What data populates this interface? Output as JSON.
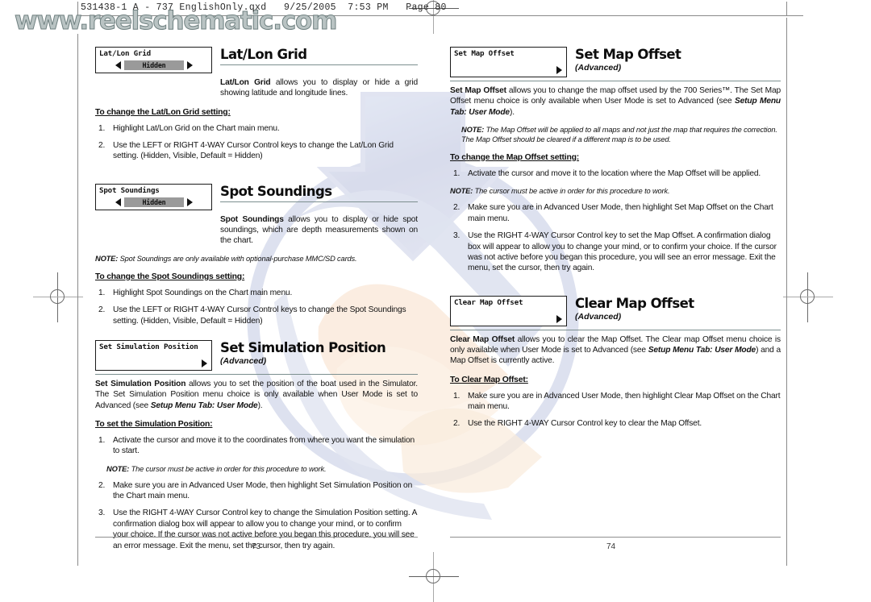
{
  "file_header": "531438-1 A - 737 EnglishOnly.qxd   9/25/2005  7:53 PM   Page 80",
  "site_watermark": "www.reelschematic.com",
  "pages": {
    "left_number": "73",
    "right_number": "74"
  },
  "left_column": {
    "sections": [
      {
        "menu": {
          "label": "Lat/Lon Grid",
          "value": "Hidden",
          "type": "option"
        },
        "title": "Lat/Lon Grid",
        "subtitle": "",
        "intro_lead": "Lat/Lon Grid",
        "intro_rest": " allows you to display or hide a grid showing latitude and longitude lines.",
        "procedure_heading": "To change the Lat/Lon Grid setting:",
        "steps": [
          {
            "num": "1.",
            "text": "Highlight Lat/Lon Grid on the Chart main menu."
          },
          {
            "num": "2.",
            "text": "Use the LEFT or RIGHT 4-WAY Cursor Control keys to change the Lat/Lon Grid setting. (Hidden, Visible, Default = Hidden)"
          }
        ]
      },
      {
        "menu": {
          "label": "Spot Soundings",
          "value": "Hidden",
          "type": "option"
        },
        "title": "Spot Soundings",
        "subtitle": "",
        "intro_lead": "Spot Soundings",
        "intro_rest": " allows you to display or hide spot soundings, which are depth measurements shown on the chart.",
        "note": {
          "label": "NOTE:",
          "text": " Spot Soundings are only available with optional-purchase MMC/SD cards."
        },
        "procedure_heading": "To change the Spot Soundings setting:",
        "steps": [
          {
            "num": "1.",
            "text": "Highlight Spot Soundings on the Chart main menu."
          },
          {
            "num": "2.",
            "text": "Use the LEFT or RIGHT 4-WAY Cursor Control keys to change the Spot Soundings setting. (Hidden, Visible, Default = Hidden)"
          }
        ]
      },
      {
        "menu": {
          "label": "Set Simulation Position",
          "value": "",
          "type": "submenu"
        },
        "title": "Set Simulation Position",
        "subtitle": "(Advanced)",
        "intro_lead": "Set Simulation Position",
        "intro_rest": " allows you to set the position of the boat used in the Simulator. The Set Simulation Position menu choice is only available when User Mode is set to Advanced (see ",
        "intro_ref": "Setup Menu Tab: User Mode",
        "intro_tail": ").",
        "procedure_heading": "To set the Simulation Position:",
        "steps": [
          {
            "num": "1.",
            "text": "Activate the cursor and move it to the coordinates from where you want the simulation to start."
          },
          {
            "num": "2.",
            "text": "Make sure you are in Advanced User Mode, then highlight Set Simulation Position on the Chart main menu."
          },
          {
            "num": "3.",
            "text": "Use the RIGHT 4-WAY Cursor Control key to change the Simulation Position setting.  A confirmation dialog box will appear to allow you to change your mind, or to confirm your choice. If the cursor was not active before you began this procedure, you will see an error message. Exit the menu, set the cursor, then try again."
          }
        ],
        "note": {
          "label": "NOTE:",
          "text": " The cursor must be active in order for this procedure to work."
        }
      }
    ]
  },
  "right_column": {
    "sections": [
      {
        "menu": {
          "label": "Set Map Offset",
          "value": "",
          "type": "submenu"
        },
        "title": "Set Map Offset",
        "subtitle": "(Advanced)",
        "intro_lead": "Set Map Offset",
        "intro_rest": " allows you to change the map offset used by the 700 Series™.  The Set Map Offset menu choice is only available when User Mode is set to Advanced (see ",
        "intro_ref": "Setup Menu Tab: User Mode",
        "intro_tail": ").",
        "note_top": {
          "label": "NOTE:",
          "text": " The Map Offset will be applied to all maps and not just the map that requires the correction. The Map Offset should be cleared if a different map is to be used."
        },
        "procedure_heading": "To change the Map Offset setting:",
        "steps": [
          {
            "num": "1.",
            "text": "Activate the cursor and move it to the location where the Map Offset will be applied."
          },
          {
            "num": "2.",
            "text": "Make sure you are in Advanced User Mode, then highlight Set Map Offset on the Chart main menu."
          },
          {
            "num": "3.",
            "text": "Use the RIGHT 4-WAY Cursor Control key to set the Map Offset. A confirmation dialog box will appear to allow you to change your mind, or to confirm your choice. If the cursor was not active before you began this procedure, you will see an error message. Exit the menu, set the cursor, then try again."
          }
        ],
        "note_mid": {
          "label": "NOTE:",
          "text": " The cursor must be active in order for this procedure to work."
        }
      },
      {
        "menu": {
          "label": "Clear Map Offset",
          "value": "",
          "type": "submenu"
        },
        "title": "Clear Map Offset",
        "subtitle": "(Advanced)",
        "intro_lead": "Clear Map Offset",
        "intro_rest": " allows you to clear the Map Offset. The Clear map Offset menu choice is only available when User Mode is set to Advanced (see ",
        "intro_ref": "Setup Menu Tab: User Mode",
        "intro_tail": ") and a Map Offset is currently active.",
        "procedure_heading": "To Clear Map Offset:",
        "steps": [
          {
            "num": "1.",
            "text": "Make sure you are in Advanced User Mode, then highlight Clear Map Offset on the Chart main menu."
          },
          {
            "num": "2.",
            "text": "Use the RIGHT 4-WAY Cursor Control key to clear the Map Offset."
          }
        ]
      }
    ]
  },
  "colors": {
    "rule": "#7c8f8f",
    "menu_pill": "#9a9a9a",
    "watermark_blue": "#b9c0dd",
    "watermark_peach": "#f6dcc2"
  }
}
